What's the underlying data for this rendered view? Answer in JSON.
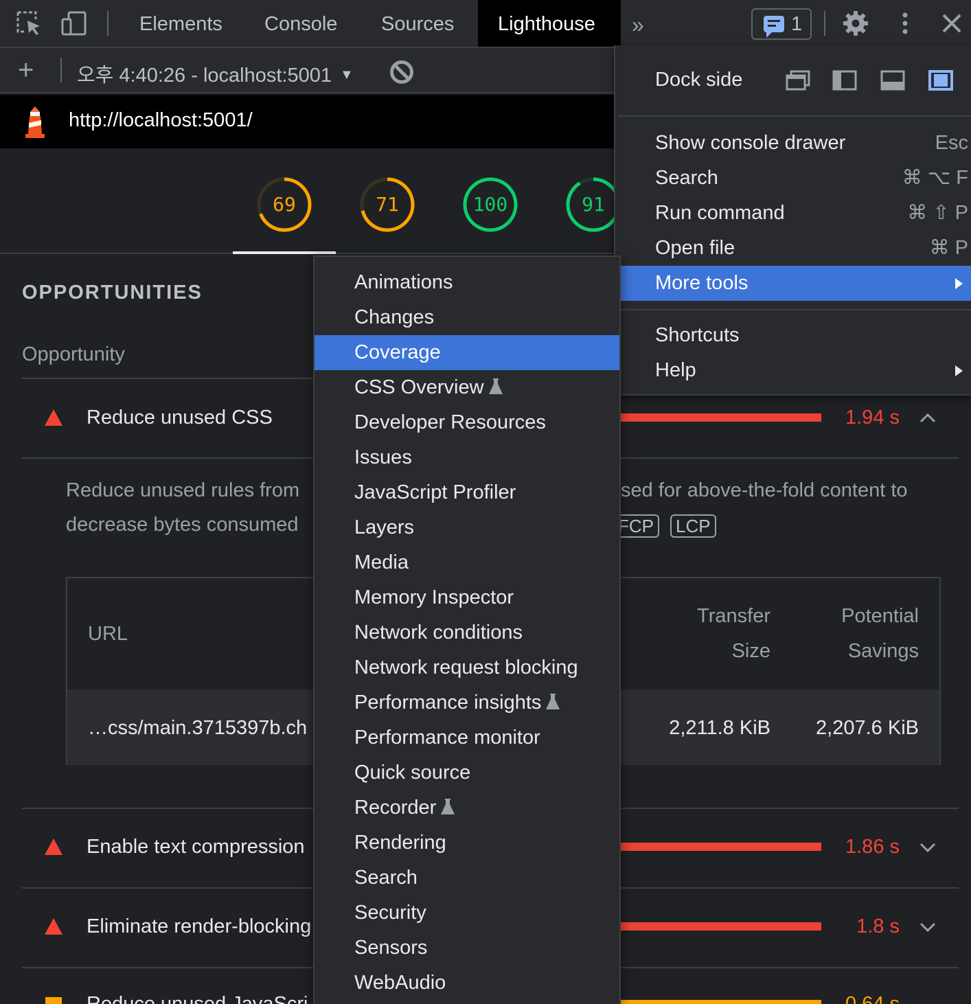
{
  "tabs": [
    "Elements",
    "Console",
    "Sources",
    "Lighthouse"
  ],
  "active_tab": "Lighthouse",
  "issues_count": "1",
  "report_select": "오후 4:40:26 - localhost:5001",
  "url": "http://localhost:5001/",
  "gauges": [
    {
      "score": "69",
      "value": 69,
      "color": "#ffa400"
    },
    {
      "score": "71",
      "value": 71,
      "color": "#ffa400"
    },
    {
      "score": "100",
      "value": 100,
      "color": "#0cce6b"
    },
    {
      "score": "91",
      "value": 91,
      "color": "#0cce6b"
    }
  ],
  "report": {
    "section_title": "OPPORTUNITIES",
    "opportunity_header": "Opportunity",
    "audits": [
      {
        "title": "Reduce unused CSS",
        "saving": "1.94 s",
        "severity": "fail"
      },
      {
        "title": "Enable text compression",
        "saving": "1.86 s",
        "severity": "fail"
      },
      {
        "title": "Eliminate render-blocking",
        "saving": "1.8 s",
        "severity": "fail"
      },
      {
        "title": "Reduce unused JavaScri",
        "saving": "0.64 s",
        "severity": "average"
      }
    ],
    "description_line1_left": "Reduce unused rules from",
    "description_line1_right": "sed for above-the-fold content to",
    "description_line2_left": "decrease bytes consumed",
    "metric_chips": [
      "FCP",
      "LCP"
    ],
    "table": {
      "col_url": "URL",
      "col_transfer_1": "Transfer",
      "col_transfer_2": "Size",
      "col_savings_1": "Potential",
      "col_savings_2": "Savings",
      "row_url": "…css/main.3715397b.ch",
      "row_transfer": "2,211.8 KiB",
      "row_savings": "2,207.6 KiB"
    }
  },
  "main_menu": {
    "dock_side_label": "Dock side",
    "items": [
      {
        "label": "Show console drawer",
        "shortcut": "Esc"
      },
      {
        "label": "Search",
        "shortcut": "⌘ ⌥ F"
      },
      {
        "label": "Run command",
        "shortcut": "⌘ ⇧ P"
      },
      {
        "label": "Open file",
        "shortcut": "⌘ P"
      },
      {
        "label": "More tools",
        "shortcut": ""
      },
      {
        "label": "Shortcuts",
        "shortcut": ""
      },
      {
        "label": "Help",
        "shortcut": ""
      }
    ],
    "highlighted": "More tools"
  },
  "more_tools": {
    "highlighted": "Coverage",
    "items": [
      {
        "label": "Animations",
        "experimental": false
      },
      {
        "label": "Changes",
        "experimental": false
      },
      {
        "label": "Coverage",
        "experimental": false
      },
      {
        "label": "CSS Overview",
        "experimental": true
      },
      {
        "label": "Developer Resources",
        "experimental": false
      },
      {
        "label": "Issues",
        "experimental": false
      },
      {
        "label": "JavaScript Profiler",
        "experimental": false
      },
      {
        "label": "Layers",
        "experimental": false
      },
      {
        "label": "Media",
        "experimental": false
      },
      {
        "label": "Memory Inspector",
        "experimental": false
      },
      {
        "label": "Network conditions",
        "experimental": false
      },
      {
        "label": "Network request blocking",
        "experimental": false
      },
      {
        "label": "Performance insights",
        "experimental": true
      },
      {
        "label": "Performance monitor",
        "experimental": false
      },
      {
        "label": "Quick source",
        "experimental": false
      },
      {
        "label": "Recorder",
        "experimental": true
      },
      {
        "label": "Rendering",
        "experimental": false
      },
      {
        "label": "Search",
        "experimental": false
      },
      {
        "label": "Security",
        "experimental": false
      },
      {
        "label": "Sensors",
        "experimental": false
      },
      {
        "label": "WebAudio",
        "experimental": false
      }
    ]
  },
  "colors": {
    "accent_blue": "#3d74d8",
    "fail_red": "#f44336",
    "average_orange": "#ffa400",
    "pass_green": "#0cce6b"
  }
}
